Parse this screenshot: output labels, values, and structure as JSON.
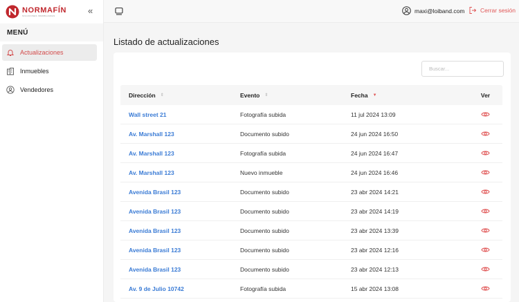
{
  "brand": {
    "name": "NORMAFÍN",
    "tagline": "SOLUCIONES INMOBILIARIAS"
  },
  "sidebar": {
    "collapse_label": "«",
    "menu_title": "MENÚ",
    "items": [
      {
        "label": "Actualizaciones",
        "icon": "bell-icon",
        "active": true
      },
      {
        "label": "Inmuebles",
        "icon": "building-icon",
        "active": false
      },
      {
        "label": "Vendedores",
        "icon": "user-circle-icon",
        "active": false
      }
    ]
  },
  "header": {
    "user_email": "maxi@loiband.com",
    "logout_label": "Cerrar sesión"
  },
  "main": {
    "title": "Listado de actualizaciones",
    "search": {
      "placeholder": "Buscar...",
      "value": ""
    },
    "columns": [
      {
        "label": "Dirección",
        "sort": "both"
      },
      {
        "label": "Evento",
        "sort": "both"
      },
      {
        "label": "Fecha",
        "sort": "desc"
      },
      {
        "label": "Ver",
        "sort": "none"
      }
    ],
    "rows": [
      {
        "address": "Wall street 21",
        "event": "Fotografía subida",
        "date": "11 jul 2024 13:09"
      },
      {
        "address": "Av. Marshall 123",
        "event": "Documento subido",
        "date": "24 jun 2024 16:50"
      },
      {
        "address": "Av. Marshall 123",
        "event": "Fotografía subida",
        "date": "24 jun 2024 16:47"
      },
      {
        "address": "Av. Marshall 123",
        "event": "Nuevo inmueble",
        "date": "24 jun 2024 16:46"
      },
      {
        "address": "Avenida Brasil 123",
        "event": "Documento subido",
        "date": "23 abr 2024 14:21"
      },
      {
        "address": "Avenida Brasil 123",
        "event": "Documento subido",
        "date": "23 abr 2024 14:19"
      },
      {
        "address": "Avenida Brasil 123",
        "event": "Documento subido",
        "date": "23 abr 2024 13:39"
      },
      {
        "address": "Avenida Brasil 123",
        "event": "Documento subido",
        "date": "23 abr 2024 12:16"
      },
      {
        "address": "Avenida Brasil 123",
        "event": "Documento subido",
        "date": "23 abr 2024 12:13"
      },
      {
        "address": "Av. 9 de Julio 10742",
        "event": "Fotografía subida",
        "date": "15 abr 2024 13:08"
      }
    ]
  },
  "colors": {
    "accent": "#e05656",
    "brand": "#c0272d",
    "link": "#3a7bd5"
  }
}
